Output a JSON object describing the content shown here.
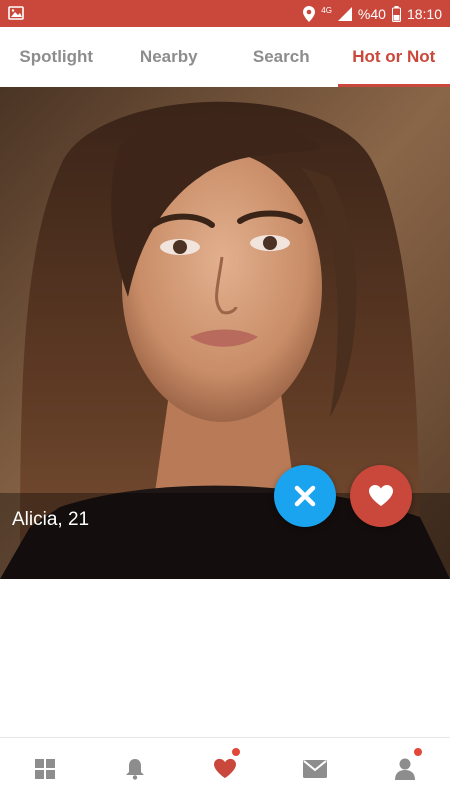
{
  "status_bar": {
    "network": "4G",
    "battery": "%40",
    "time": "18:10"
  },
  "tabs": [
    {
      "label": "Spotlight",
      "active": false
    },
    {
      "label": "Nearby",
      "active": false
    },
    {
      "label": "Search",
      "active": false
    },
    {
      "label": "Hot or Not",
      "active": true
    }
  ],
  "profile": {
    "name_age": "Alicia, 21"
  },
  "actions": {
    "dislike_icon": "close-icon",
    "like_icon": "heart-icon"
  },
  "bottom_nav": [
    {
      "icon": "grid-icon",
      "badge": false
    },
    {
      "icon": "bell-icon",
      "badge": true
    },
    {
      "icon": "heart-icon",
      "badge": false,
      "active": true
    },
    {
      "icon": "mail-icon",
      "badge": false
    },
    {
      "icon": "user-icon",
      "badge": true
    }
  ],
  "colors": {
    "primary": "#c9483b",
    "dislike": "#1aa3ef",
    "inactive": "#8d8d8d"
  }
}
